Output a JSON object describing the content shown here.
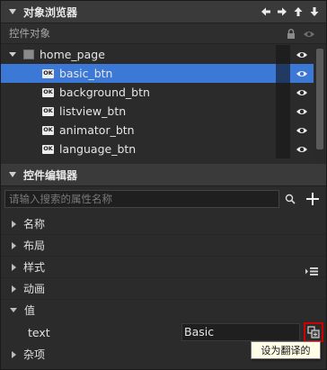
{
  "object_browser": {
    "title": "对象浏览器",
    "column_header": "控件对象",
    "tree": [
      {
        "label": "home_page",
        "type": "page",
        "expanded": true
      },
      {
        "label": "basic_btn",
        "type": "button",
        "selected": true
      },
      {
        "label": "background_btn",
        "type": "button"
      },
      {
        "label": "listview_btn",
        "type": "button"
      },
      {
        "label": "animator_btn",
        "type": "button"
      },
      {
        "label": "language_btn",
        "type": "button"
      }
    ],
    "node_icon_text": "OK"
  },
  "property_editor": {
    "title": "控件编辑器",
    "search_placeholder": "请输入搜索的属性名称",
    "groups": [
      {
        "label": "名称",
        "expanded": false
      },
      {
        "label": "布局",
        "expanded": false
      },
      {
        "label": "样式",
        "expanded": false
      },
      {
        "label": "动画",
        "expanded": false
      },
      {
        "label": "值",
        "expanded": true
      },
      {
        "label": "杂项",
        "expanded": false
      }
    ],
    "text_property": {
      "name": "text",
      "value": "Basic"
    },
    "tooltip": "设为翻译的"
  },
  "colors": {
    "selection": "#3c78d6",
    "highlight_border": "#d00000",
    "panel_bg": "#2b2b2b"
  }
}
